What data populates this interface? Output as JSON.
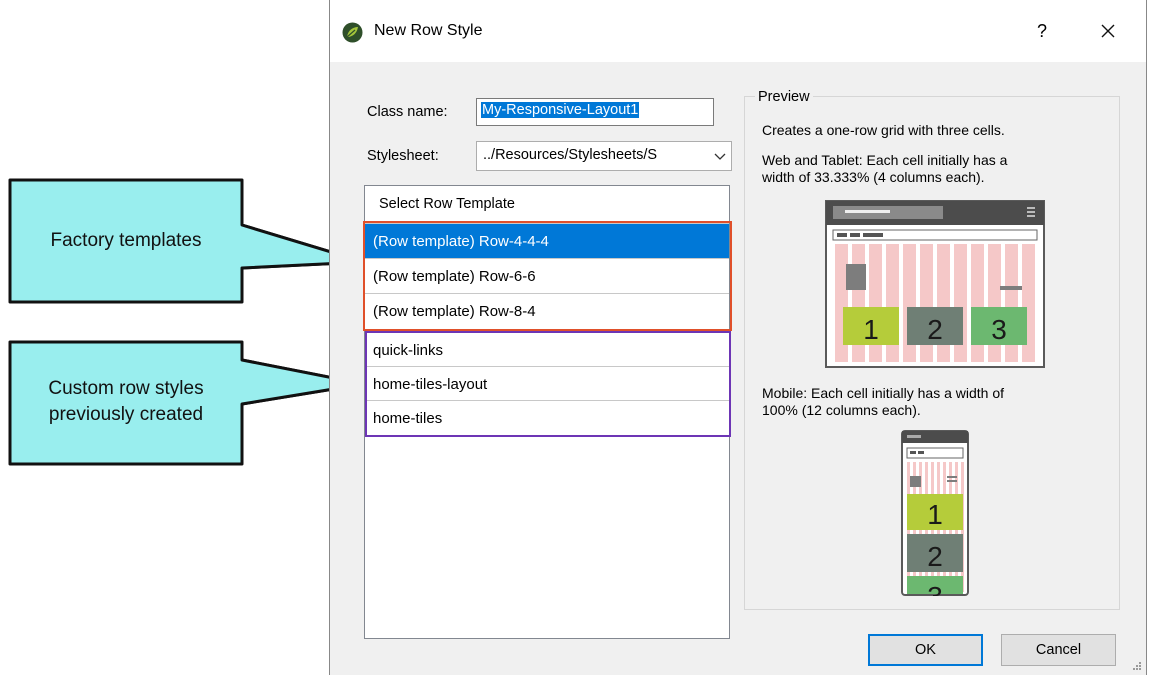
{
  "callouts": {
    "factory": "Factory templates",
    "custom_line1": "Custom row styles",
    "custom_line2": "previously created"
  },
  "dialog": {
    "title": "New Row Style",
    "help": "?",
    "class_name_label": "Class name:",
    "class_name_value": "My-Responsive-Layout1",
    "stylesheet_label": "Stylesheet:",
    "stylesheet_value": "../Resources/Stylesheets/S",
    "list_header": "Select Row Template",
    "templates": [
      "(Row template) Row-4-4-4",
      "(Row template) Row-6-6",
      "(Row template) Row-8-4",
      "quick-links",
      "home-tiles-layout",
      "home-tiles"
    ],
    "preview": {
      "legend": "Preview",
      "line1": "Creates a one-row grid with three cells.",
      "web_line1": "Web and Tablet: Each cell initially has a",
      "web_line2": "width of 33.333% (4 columns each).",
      "mobile_line1": "Mobile: Each cell initially has a width of",
      "mobile_line2": "100% (12 columns each).",
      "cell_numbers": [
        "1",
        "2",
        "3"
      ]
    },
    "ok_label": "OK",
    "cancel_label": "Cancel"
  },
  "colors": {
    "callout_fill": "#99eeee",
    "factory_outline": "#e0502a",
    "custom_outline": "#6d35b5",
    "selection": "#0078d7",
    "cell1": "#b5cc3a",
    "cell2": "#6f7f75",
    "cell3": "#6cb870"
  }
}
